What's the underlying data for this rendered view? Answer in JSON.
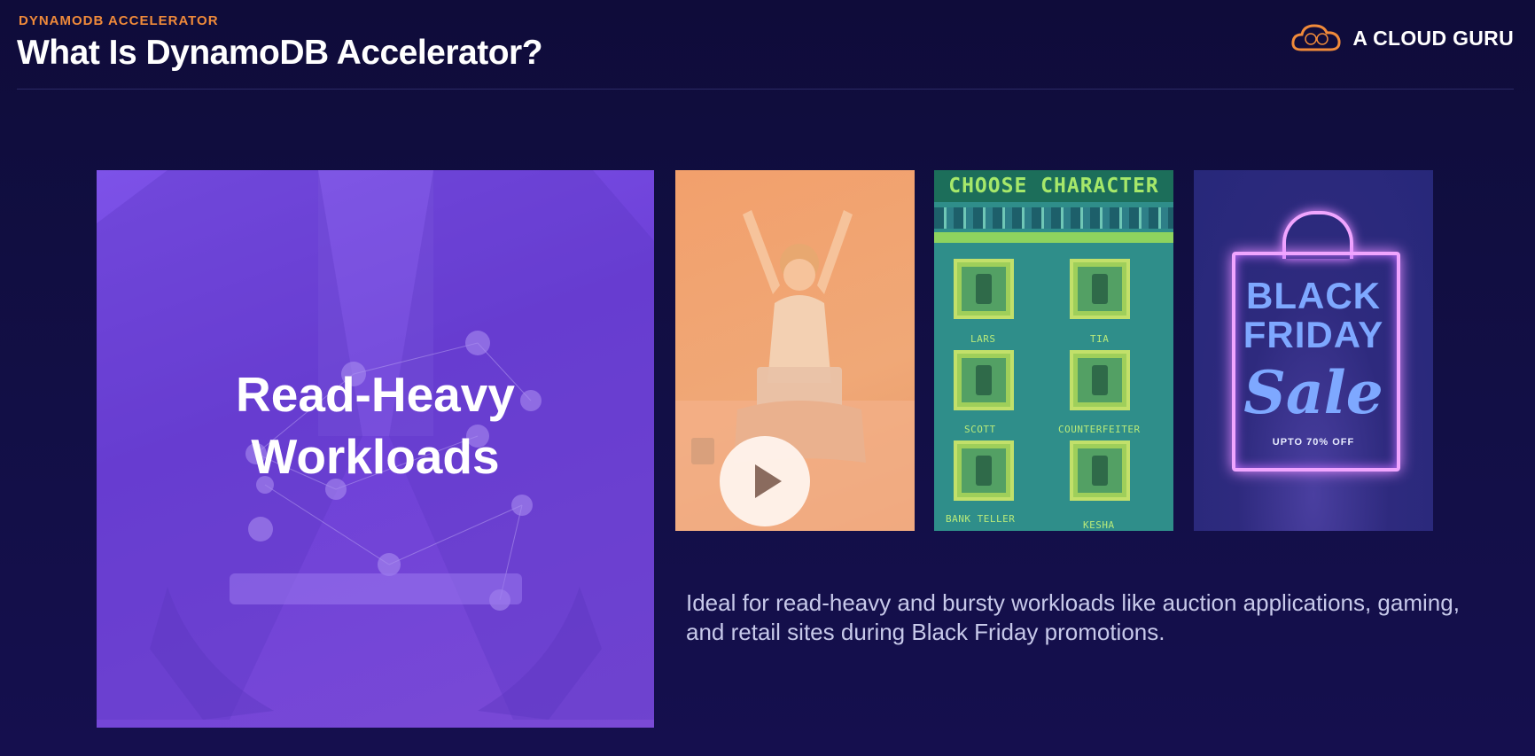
{
  "header": {
    "eyebrow": "DYNAMODB ACCELERATOR",
    "title": "What Is DynamoDB Accelerator?",
    "brand_name": "A CLOUD GURU"
  },
  "hero": {
    "title_line1": "Read-Heavy",
    "title_line2": "Workloads"
  },
  "panels": {
    "video": {
      "icon": "play-icon"
    },
    "game": {
      "heading": "CHOOSE CHARACTER",
      "characters": [
        "LARS",
        "TIA",
        "SCOTT",
        "COUNTERFEITER",
        "BANK TELLER",
        "KESHA"
      ]
    },
    "sale": {
      "line1": "BLACK",
      "line2": "FRIDAY",
      "line3": "Sale",
      "subtext": "UPTO 70% OFF"
    }
  },
  "description": "Ideal for read-heavy and bursty workloads like auction applications, gaming, and retail sites during Black Friday promotions.",
  "colors": {
    "background": "#120f45",
    "accent": "#f08a3a",
    "hero_overlay": "#7048de",
    "text_muted": "#c7c9ea"
  }
}
